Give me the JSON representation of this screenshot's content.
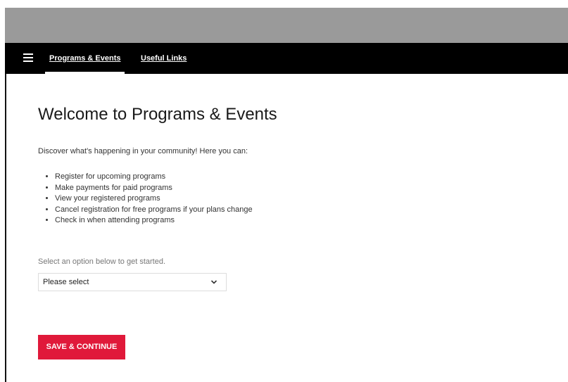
{
  "nav": {
    "tabs": [
      {
        "label": "Programs & Events",
        "active": true
      },
      {
        "label": "Useful Links",
        "active": false
      }
    ],
    "menu_icon": "hamburger-menu-icon"
  },
  "main": {
    "title": "Welcome to Programs & Events",
    "intro": "Discover what's happening in your community! Here you can:",
    "features": [
      "Register for upcoming programs",
      "Make payments for paid programs",
      "View your registered programs",
      "Cancel registration for free programs if your plans change",
      "Check in when attending programs"
    ],
    "select_label": "Select an option below to get started.",
    "select_value": "Please select",
    "select_icon": "chevron-down-icon",
    "save_label": "SAVE & CONTINUE"
  },
  "colors": {
    "banner": "#9a9a9a",
    "navbar": "#000000",
    "accent": "#e0193a"
  }
}
